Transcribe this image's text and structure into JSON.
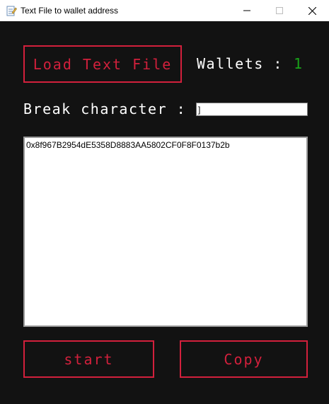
{
  "window": {
    "title": "Text File to wallet address",
    "minimize_label": "—",
    "maximize_label": "☐",
    "close_label": "✕"
  },
  "toolbar": {
    "load_label": "Load Text File",
    "wallets_label": "Wallets :",
    "wallets_count": "1"
  },
  "break_char": {
    "label": "Break character :",
    "value": "]"
  },
  "editor": {
    "value": "0x8f967B2954dE5358D8883AA5802CF0F8F0137b2b\n"
  },
  "actions": {
    "start_label": "start",
    "copy_label": "Copy"
  },
  "colors": {
    "accent": "#d2203c",
    "count": "#19a319",
    "background": "#121212"
  }
}
